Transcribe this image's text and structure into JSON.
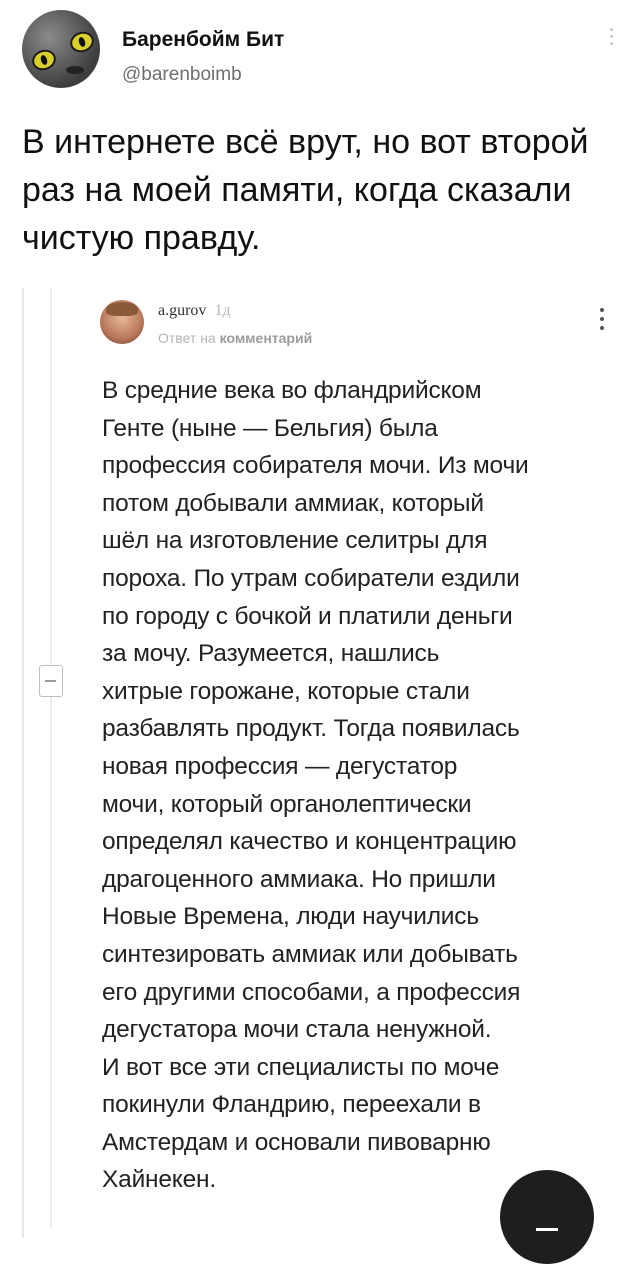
{
  "tweet": {
    "author_name": "Баренбойм Бит",
    "author_handle": "@barenboimb",
    "text": "В интернете всё врут, но вот второй раз на моей памяти, когда сказали чистую правду."
  },
  "comment": {
    "author": "a.gurov",
    "age": "1д",
    "reply_prefix": "Ответ на",
    "reply_target": "комментарий",
    "lines": [
      "В средние века во фландрийском",
      "Генте (ныне — Бельгия) была",
      "профессия собирателя мочи. Из мочи",
      "потом добывали аммиак, который",
      "шёл на изготовление селитры для",
      "пороха. По утрам собиратели ездили",
      "по городу с бочкой и платили деньги",
      "за мочу. Разумеется, нашлись",
      "хитрые горожане, которые стали",
      "разбавлять продукт. Тогда появилась",
      "новая профессия — дегустатор",
      "мочи, который органолептически",
      "определял качество и концентрацию",
      "драгоценного аммиака. Но пришли",
      "Новые Времена, люди научились",
      "синтезировать аммиак или добывать",
      "его другими способами, а профессия",
      "дегустатора мочи стала ненужной.",
      "И вот все эти специалисты по моче",
      "покинули Фландрию, переехали в",
      "Амстердам и основали пивоварню",
      "Хайнекен."
    ]
  },
  "icons": {
    "more": "more-vertical-icon",
    "collapse": "collapse-minus-icon",
    "fab": "compose-icon"
  }
}
